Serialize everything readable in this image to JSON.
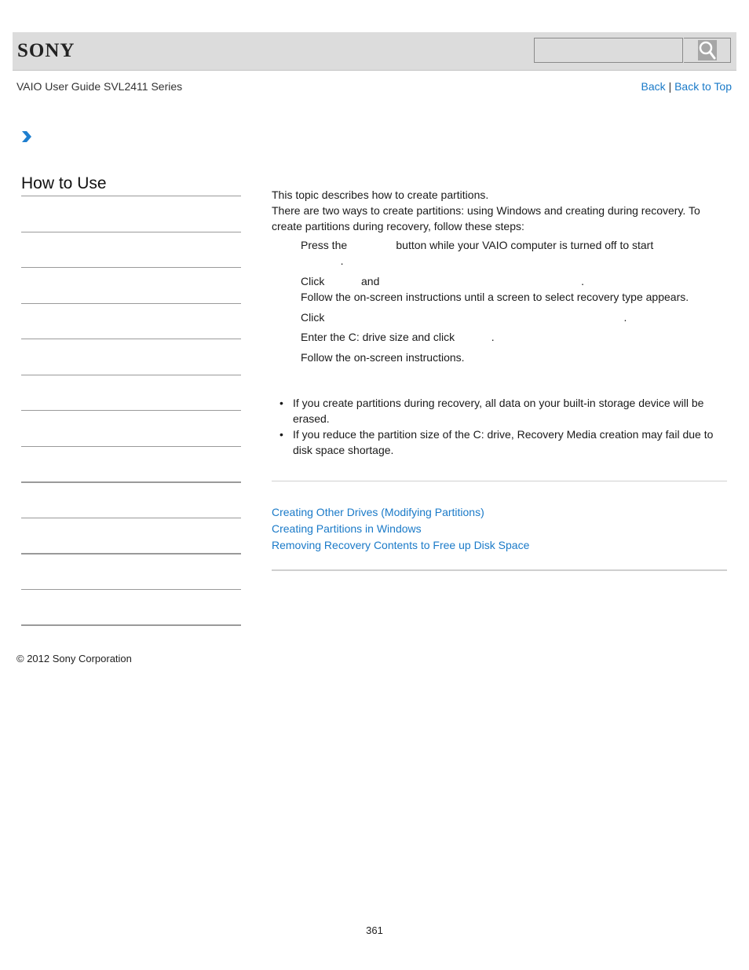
{
  "header": {
    "logo": "SONY",
    "search": {
      "placeholder": "",
      "value": ""
    },
    "search_icon": "search-icon"
  },
  "guide_title": "VAIO User Guide SVL2411 Series",
  "top_nav": {
    "back": "Back",
    "separator": "|",
    "back_to_top": "Back to Top"
  },
  "breadcrumb_icon": "chevron-right-icon",
  "sidebar": {
    "title": "How to Use"
  },
  "content": {
    "intro": "This topic describes how to create partitions.",
    "paragraph": "There are two ways to create partitions: using Windows and creating during recovery. To create partitions during recovery, follow these steps:",
    "steps": [
      "Press the                button while your VAIO computer is turned off to start",
      "             .",
      "Click            and                                                                  .",
      "Follow the on-screen instructions until a screen to select recovery type appears.",
      "Click                                                                                                  .",
      "Enter the C: drive size and click            .",
      "Follow the on-screen instructions."
    ],
    "notes": [
      "If you create partitions during recovery, all data on your built-in storage device will be erased.",
      "If you reduce the partition size of the C: drive, Recovery Media creation may fail due to disk space shortage."
    ],
    "related_links": [
      "Creating Other Drives (Modifying Partitions)",
      "Creating Partitions in Windows",
      "Removing Recovery Contents to Free up Disk Space"
    ]
  },
  "footer": {
    "copyright": "© 2012 Sony Corporation",
    "page_number": "361"
  },
  "colors": {
    "link": "#1a7ac8",
    "header_bg": "#dcdcdc",
    "chevron": "#1f7fcf"
  }
}
